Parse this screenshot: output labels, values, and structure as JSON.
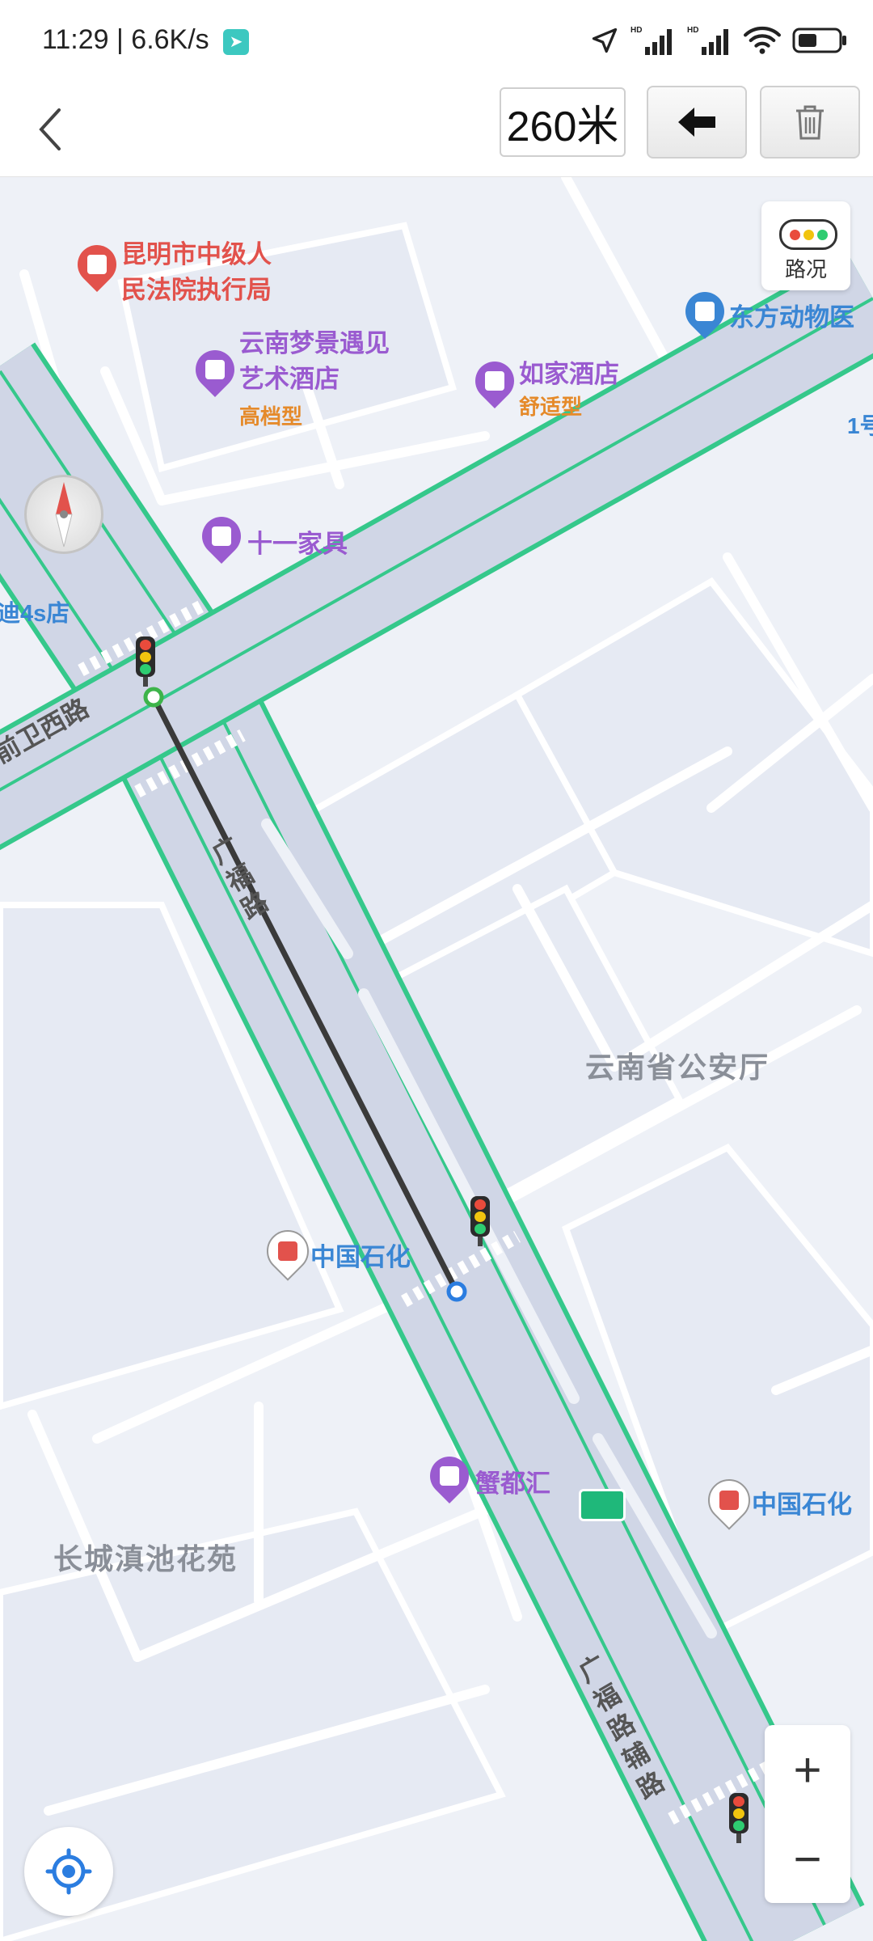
{
  "status_bar": {
    "time_speed": "11:29 | 6.6K/s"
  },
  "toolbar": {
    "distance": "260米"
  },
  "map": {
    "traffic_label": "路况",
    "zoom_in": "+",
    "zoom_out": "−",
    "pois": {
      "court_line1": "昆明市中级人",
      "court_line2": "民法院执行局",
      "hotel1_line1": "云南梦景遇见",
      "hotel1_line2": "艺术酒店",
      "hotel1_type": "高档型",
      "hotel2_name": "如家酒店",
      "hotel2_type": "舒适型",
      "animal_hospital": "东方动物医",
      "furniture": "十一家具",
      "shop_4s": "迪4s店",
      "sinopec1": "中国石化",
      "sinopec2": "中国石化",
      "crab": "蟹都汇",
      "right_edge": "1号"
    },
    "roads": {
      "qianwei_west": "前卫西路",
      "guangfu_1": "广",
      "guangfu_2": "福",
      "guangfu_3": "路",
      "guangfu_aux_1": "广",
      "guangfu_aux_2": "福",
      "guangfu_aux_3": "路",
      "guangfu_aux_4": "辅",
      "guangfu_aux_5": "路"
    },
    "areas": {
      "police_dept": "云南省公安厅",
      "garden": "长城滇池花苑"
    }
  },
  "colors": {
    "road_edge": "#35c88b",
    "road_fill": "#d0d6e6",
    "measure_line": "#3a3a3a",
    "start_point": "#3db44a",
    "end_point": "#2b7de0",
    "poi_purple": "#9a5bd0",
    "poi_red": "#e2524c",
    "poi_blue": "#3a86d4"
  },
  "icons": [
    "back-icon",
    "undo-arrow-icon",
    "trash-icon",
    "location-arrow-icon",
    "signal-icon",
    "wifi-icon",
    "battery-icon",
    "traffic-light-icon",
    "compass-icon",
    "locate-icon"
  ]
}
